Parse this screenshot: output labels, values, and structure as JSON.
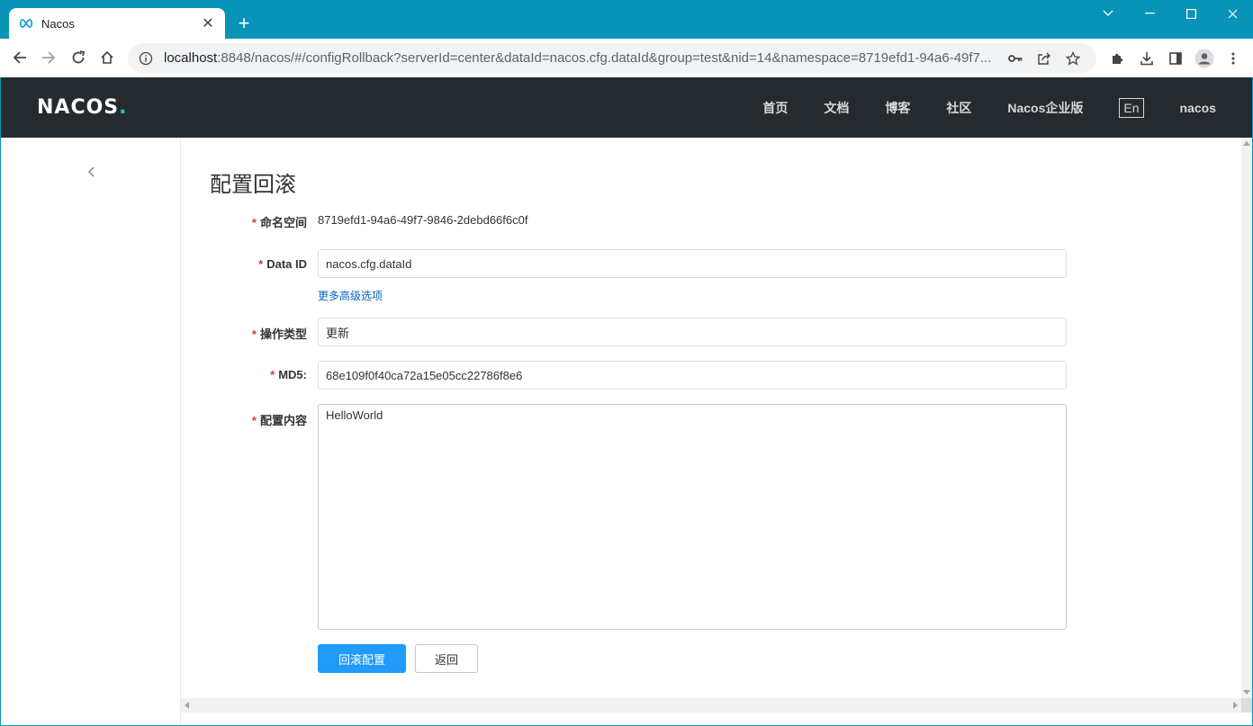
{
  "browser": {
    "tab_title": "Nacos",
    "url_host": "localhost",
    "url_rest": ":8848/nacos/#/configRollback?serverId=center&dataId=nacos.cfg.dataId&group=test&nid=14&namespace=8719efd1-94a6-49f7..."
  },
  "header": {
    "logo_text": "NACOS",
    "logo_dot": ".",
    "nav": [
      "首页",
      "文档",
      "博客",
      "社区",
      "Nacos企业版"
    ],
    "lang": "En",
    "user": "nacos"
  },
  "form": {
    "title": "配置回滚",
    "namespace_label": "命名空间",
    "namespace_value": "8719efd1-94a6-49f7-9846-2debd66f6c0f",
    "dataid_label": "Data ID",
    "dataid_value": "nacos.cfg.dataId",
    "advanced_link": "更多高级选项",
    "optype_label": "操作类型",
    "optype_value": "更新",
    "md5_label": "MD5:",
    "md5_value": "68e109f0f40ca72a15e05cc22786f8e6",
    "content_label": "配置内容",
    "content_value": "HelloWorld",
    "required_mark": "*",
    "rollback_button": "回滚配置",
    "back_button": "返回"
  },
  "colors": {
    "accent": "#209bfa",
    "header_bg": "#252a2f",
    "browser_frame": "#0794b8",
    "required": "#d23c26",
    "link": "#0064c8"
  }
}
